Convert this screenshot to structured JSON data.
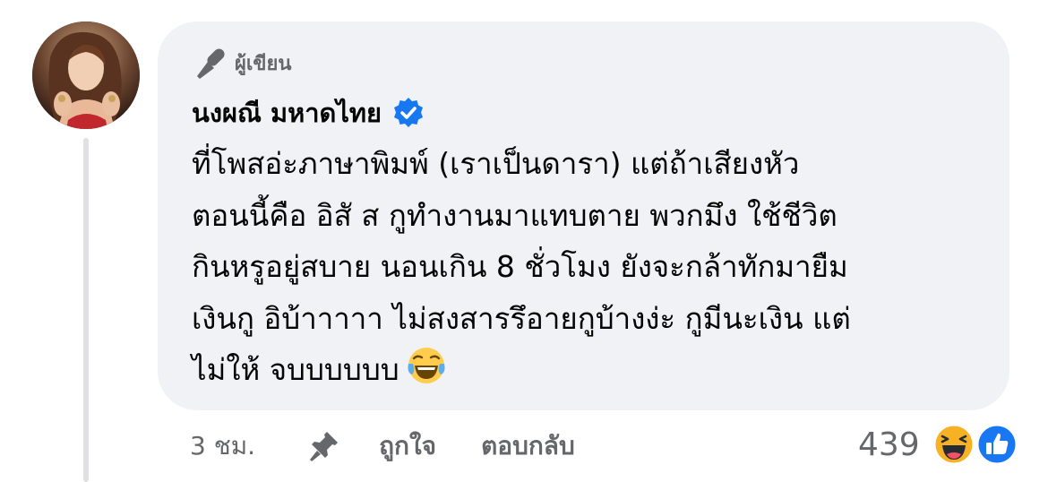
{
  "comment": {
    "badge": "ผู้เขียน",
    "author": "นงผณี มหาดไทย",
    "verified": true,
    "text_lines": [
      "ที่โพสอ่ะภาษาพิมพ์ (เราเป็นดารา) แต่ถ้าเสียงหัว",
      "ตอนนี้คือ อิสั ส กูทำงานมาแทบตาย พวกมึง ใช้ชีวิต",
      "กินหรูอยู่สบาย นอนเกิน 8 ชั่วโมง ยังจะกล้าทักมายืม",
      "เงินกู อิบ้าาาาา ไม่สงสารรึอายกูบ้างง่ะ กูมีนะเงิน แต่",
      "ไม่ให้ จบบบบบบ"
    ],
    "inline_emoji": "laughing-tears-emoji"
  },
  "actions": {
    "time": "3 ชม.",
    "like_label": "ถูกใจ",
    "reply_label": "ตอบกลับ"
  },
  "reactions": {
    "count": "439",
    "types": [
      "haha",
      "like"
    ]
  },
  "colors": {
    "bubble": "#f0f2f5",
    "secondary_text": "#65676b",
    "verified_blue": "#1877f2",
    "like_blue": "#1877f2",
    "haha_yellow": "#f7b125"
  }
}
